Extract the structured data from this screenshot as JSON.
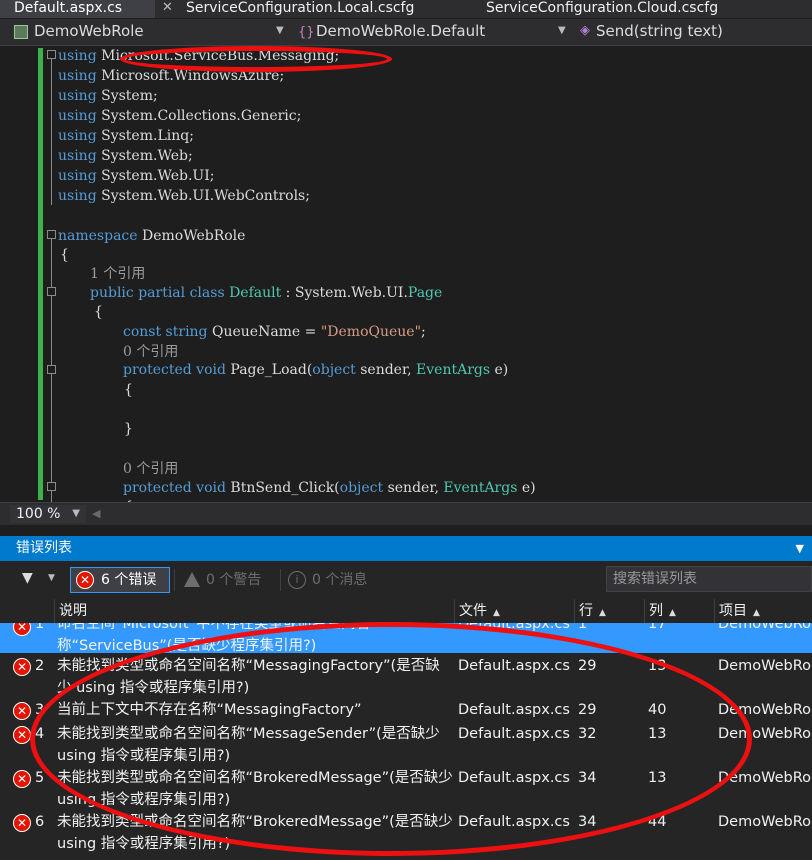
{
  "tabs": [
    {
      "label": "Default.aspx.cs",
      "active": true
    },
    {
      "label": "ServiceConfiguration.Local.cscfg",
      "active": false
    },
    {
      "label": "ServiceConfiguration.Cloud.cscfg",
      "active": false
    }
  ],
  "tab_close_glyph": "✕",
  "navbar": {
    "project": "DemoWebRole",
    "type": "DemoWebRole.Default",
    "member": "Send(string text)"
  },
  "code": {
    "usings": [
      {
        "kw": "using",
        "ns": " Microsoft.ServiceBus.Messaging;"
      },
      {
        "kw": "using",
        "ns": " Microsoft.WindowsAzure;"
      },
      {
        "kw": "using",
        "ns": " System;"
      },
      {
        "kw": "using",
        "ns": " System.Collections.Generic;"
      },
      {
        "kw": "using",
        "ns": " System.Linq;"
      },
      {
        "kw": "using",
        "ns": " System.Web;"
      },
      {
        "kw": "using",
        "ns": " System.Web.UI;"
      },
      {
        "kw": "using",
        "ns": " System.Web.UI.WebControls;"
      }
    ],
    "namespace_kw": "namespace",
    "namespace_name": " DemoWebRole",
    "brace_open": "{",
    "brace_close": "}",
    "ref_1": "1 个引用",
    "ref_0": "0 个引用",
    "class_public": "public",
    "class_partial": " partial",
    "class_kw": " class",
    "class_name": " Default",
    "class_colon": " : System.Web.UI.",
    "class_base": "Page",
    "const_kw": "const",
    "const_type": " string",
    "const_name": " QueueName = ",
    "const_value": "\"DemoQueue\"",
    "const_end": ";",
    "method1_mod": "protected",
    "method1_void": " void",
    "method1_name": " Page_Load(",
    "method1_obj": "object",
    "method1_sender": " sender, ",
    "method1_args": "EventArgs",
    "method1_end": " e)",
    "method2_mod": "protected",
    "method2_void": " void",
    "method2_name": " BtnSend_Click(",
    "method2_obj": "object",
    "method2_sender": " sender, ",
    "method2_args": "EventArgs",
    "method2_end": " e)",
    "partial_brace": "{"
  },
  "zoom": "100 %",
  "error_list": {
    "title": "错误列表",
    "errors_label": "6 个错误",
    "warnings_label": "0 个警告",
    "messages_label": "0 个消息",
    "search_placeholder": "搜索错误列表",
    "columns": [
      "说明",
      "文件",
      "行",
      "列",
      "项目"
    ],
    "rows": [
      {
        "num": "1",
        "desc": "命名空间“Microsoft”中不存在类型或命名空间名称“ServiceBus”(是否缺少程序集引用?)",
        "file": "Default.aspx.cs",
        "line": "1",
        "col": "17",
        "project": "DemoWebRole",
        "selected": true
      },
      {
        "num": "2",
        "desc": "未能找到类型或命名空间名称“MessagingFactory”(是否缺少 using 指令或程序集引用?)",
        "file": "Default.aspx.cs",
        "line": "29",
        "col": "13",
        "project": "DemoWebRole",
        "selected": false
      },
      {
        "num": "3",
        "desc": "当前上下文中不存在名称“MessagingFactory”",
        "file": "Default.aspx.cs",
        "line": "29",
        "col": "40",
        "project": "DemoWebRole",
        "selected": false
      },
      {
        "num": "4",
        "desc": "未能找到类型或命名空间名称“MessageSender”(是否缺少 using 指令或程序集引用?)",
        "file": "Default.aspx.cs",
        "line": "32",
        "col": "13",
        "project": "DemoWebRole",
        "selected": false
      },
      {
        "num": "5",
        "desc": "未能找到类型或命名空间名称“BrokeredMessage”(是否缺少 using 指令或程序集引用?)",
        "file": "Default.aspx.cs",
        "line": "34",
        "col": "13",
        "project": "DemoWebRole",
        "selected": false
      },
      {
        "num": "6",
        "desc": "未能找到类型或命名空间名称“BrokeredMessage”(是否缺少 using 指令或程序集引用?)",
        "file": "Default.aspx.cs",
        "line": "34",
        "col": "44",
        "project": "DemoWebRole",
        "selected": false
      }
    ]
  },
  "colors": {
    "keyword": "#569cd6",
    "type": "#4ec9b0",
    "string": "#d69d85",
    "accent": "#007acc",
    "error": "#e51400",
    "annotation": "#ee1010"
  }
}
